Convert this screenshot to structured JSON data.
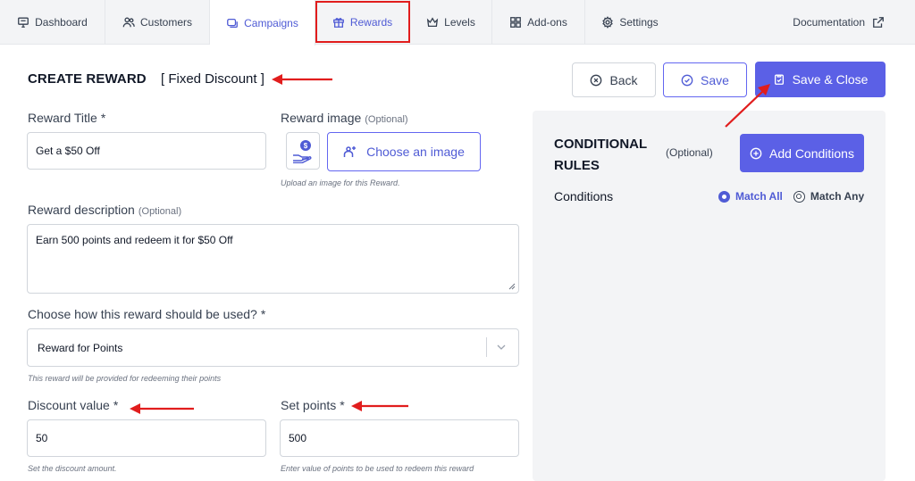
{
  "nav": {
    "tabs": [
      {
        "label": "Dashboard",
        "icon": "monitor-icon"
      },
      {
        "label": "Customers",
        "icon": "users-icon"
      },
      {
        "label": "Campaigns",
        "icon": "megaphone-icon"
      },
      {
        "label": "Rewards",
        "icon": "gift-icon"
      },
      {
        "label": "Levels",
        "icon": "crown-icon"
      },
      {
        "label": "Add-ons",
        "icon": "grid-icon"
      },
      {
        "label": "Settings",
        "icon": "gear-icon"
      }
    ],
    "documentation": "Documentation"
  },
  "page": {
    "title": "CREATE REWARD",
    "subtitle": "[ Fixed Discount ]"
  },
  "buttons": {
    "back": "Back",
    "save": "Save",
    "save_close": "Save & Close"
  },
  "form": {
    "reward_title_label": "Reward Title",
    "required": "*",
    "reward_title_value": "Get a $50 Off",
    "reward_image_label": "Reward image",
    "optional": "(Optional)",
    "choose_image": "Choose an image",
    "image_help": "Upload an image for this Reward.",
    "description_label": "Reward description",
    "description_value": "Earn 500 points and redeem it for $50 Off",
    "usage_label": "Choose how this reward should be used?",
    "usage_value": "Reward for Points",
    "usage_help": "This reward will be provided for redeeming their points",
    "discount_label": "Discount value",
    "discount_value": "50",
    "discount_help": "Set the discount amount.",
    "points_label": "Set points",
    "points_value": "500",
    "points_help": "Enter value of points to be used to redeem this reward"
  },
  "conditions": {
    "title_line1": "CONDITIONAL",
    "title_line2": "RULES",
    "optional": "(Optional)",
    "add_button": "Add Conditions",
    "conditions_label": "Conditions",
    "match_all": "Match All",
    "match_any": "Match Any"
  },
  "colors": {
    "accent": "#5b60e6",
    "annotation": "#e11d1d"
  }
}
